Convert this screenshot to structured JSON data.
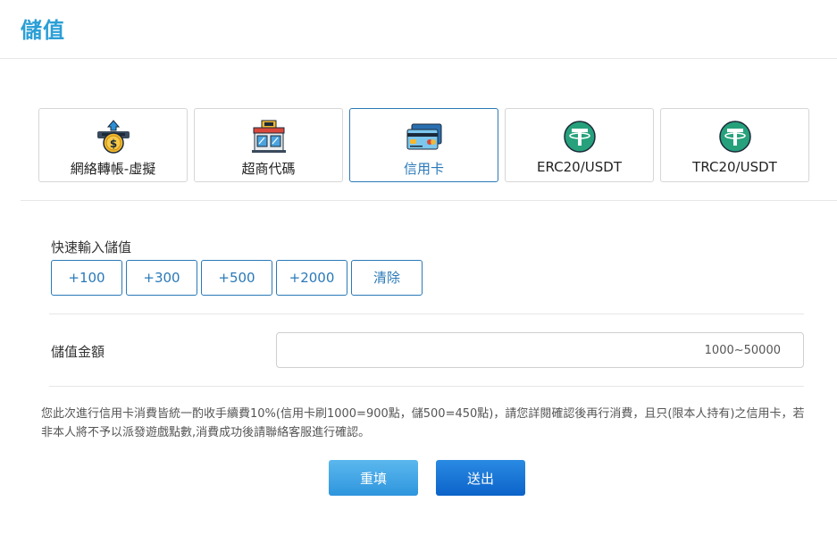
{
  "page": {
    "title": "儲值"
  },
  "methods": [
    {
      "label": "網絡轉帳-虛擬",
      "icon": "atm-coin-icon",
      "active": false
    },
    {
      "label": "超商代碼",
      "icon": "convenience-store-icon",
      "active": false
    },
    {
      "label": "信用卡",
      "icon": "credit-card-icon",
      "active": true
    },
    {
      "label": "ERC20/USDT",
      "icon": "tether-icon",
      "active": false
    },
    {
      "label": "TRC20/USDT",
      "icon": "tether-icon",
      "active": false
    }
  ],
  "quick": {
    "label": "快速輸入儲值",
    "buttons": [
      "+100",
      "+300",
      "+500",
      "+2000",
      "清除"
    ]
  },
  "amount": {
    "label": "儲值金額",
    "placeholder": "1000~50000",
    "value": ""
  },
  "notice": "您此次進行信用卡消費皆統一酌收手續費10%(信用卡刷1000=900點，儲500=450點)，請您詳閱確認後再行消費，且只(限本人持有)之信用卡，若非本人將不予以派發遊戲點數,消費成功後請聯絡客服進行確認。",
  "actions": {
    "reset": "重填",
    "submit": "送出"
  },
  "colors": {
    "title": "#2a9fd6",
    "accent": "#2a79b8",
    "tether": "#26a17b"
  }
}
